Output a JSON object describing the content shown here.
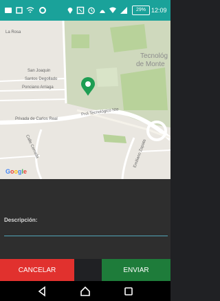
{
  "status_bar": {
    "battery": "29%",
    "time": "12:09",
    "icons": [
      "notification-icon",
      "square-icon",
      "wifi-icon",
      "settings-icon",
      "location-icon",
      "nfc-icon",
      "signal-icon",
      "alarm-icon"
    ]
  },
  "map": {
    "streets": [
      "La Rosa",
      "San Joaquin",
      "Santos Degollado",
      "Ponciano Arriaga",
      "Privada de Carlos Real",
      "Prol Tecnológico Nte",
      "Calle Cerrada",
      "Emiliano Zapata"
    ],
    "poi": [
      "Tecnológ",
      "de Monte"
    ],
    "attribution": "Google",
    "marker_color": "#1e9e53"
  },
  "form": {
    "description_label": "Descripción:",
    "description_value": ""
  },
  "buttons": {
    "cancel": "CANCELAR",
    "send": "ENVIAR"
  },
  "colors": {
    "status_bar": "#1aa29a",
    "cancel": "#e1312e",
    "send": "#1e7c3a",
    "accent": "#52a6ba"
  }
}
